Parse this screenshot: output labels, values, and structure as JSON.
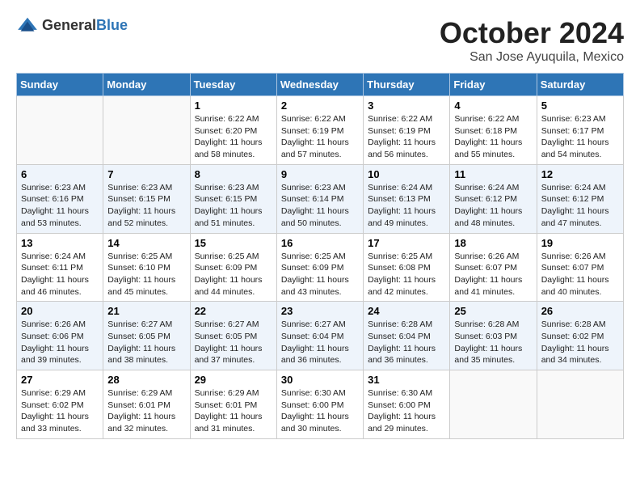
{
  "header": {
    "logo_general": "General",
    "logo_blue": "Blue",
    "month": "October 2024",
    "location": "San Jose Ayuquila, Mexico"
  },
  "weekdays": [
    "Sunday",
    "Monday",
    "Tuesday",
    "Wednesday",
    "Thursday",
    "Friday",
    "Saturday"
  ],
  "weeks": [
    [
      {
        "day": "",
        "empty": true
      },
      {
        "day": "",
        "empty": true
      },
      {
        "day": "1",
        "sunrise": "6:22 AM",
        "sunset": "6:20 PM",
        "daylight": "11 hours and 58 minutes."
      },
      {
        "day": "2",
        "sunrise": "6:22 AM",
        "sunset": "6:19 PM",
        "daylight": "11 hours and 57 minutes."
      },
      {
        "day": "3",
        "sunrise": "6:22 AM",
        "sunset": "6:19 PM",
        "daylight": "11 hours and 56 minutes."
      },
      {
        "day": "4",
        "sunrise": "6:22 AM",
        "sunset": "6:18 PM",
        "daylight": "11 hours and 55 minutes."
      },
      {
        "day": "5",
        "sunrise": "6:23 AM",
        "sunset": "6:17 PM",
        "daylight": "11 hours and 54 minutes."
      }
    ],
    [
      {
        "day": "6",
        "sunrise": "6:23 AM",
        "sunset": "6:16 PM",
        "daylight": "11 hours and 53 minutes."
      },
      {
        "day": "7",
        "sunrise": "6:23 AM",
        "sunset": "6:15 PM",
        "daylight": "11 hours and 52 minutes."
      },
      {
        "day": "8",
        "sunrise": "6:23 AM",
        "sunset": "6:15 PM",
        "daylight": "11 hours and 51 minutes."
      },
      {
        "day": "9",
        "sunrise": "6:23 AM",
        "sunset": "6:14 PM",
        "daylight": "11 hours and 50 minutes."
      },
      {
        "day": "10",
        "sunrise": "6:24 AM",
        "sunset": "6:13 PM",
        "daylight": "11 hours and 49 minutes."
      },
      {
        "day": "11",
        "sunrise": "6:24 AM",
        "sunset": "6:12 PM",
        "daylight": "11 hours and 48 minutes."
      },
      {
        "day": "12",
        "sunrise": "6:24 AM",
        "sunset": "6:12 PM",
        "daylight": "11 hours and 47 minutes."
      }
    ],
    [
      {
        "day": "13",
        "sunrise": "6:24 AM",
        "sunset": "6:11 PM",
        "daylight": "11 hours and 46 minutes."
      },
      {
        "day": "14",
        "sunrise": "6:25 AM",
        "sunset": "6:10 PM",
        "daylight": "11 hours and 45 minutes."
      },
      {
        "day": "15",
        "sunrise": "6:25 AM",
        "sunset": "6:09 PM",
        "daylight": "11 hours and 44 minutes."
      },
      {
        "day": "16",
        "sunrise": "6:25 AM",
        "sunset": "6:09 PM",
        "daylight": "11 hours and 43 minutes."
      },
      {
        "day": "17",
        "sunrise": "6:25 AM",
        "sunset": "6:08 PM",
        "daylight": "11 hours and 42 minutes."
      },
      {
        "day": "18",
        "sunrise": "6:26 AM",
        "sunset": "6:07 PM",
        "daylight": "11 hours and 41 minutes."
      },
      {
        "day": "19",
        "sunrise": "6:26 AM",
        "sunset": "6:07 PM",
        "daylight": "11 hours and 40 minutes."
      }
    ],
    [
      {
        "day": "20",
        "sunrise": "6:26 AM",
        "sunset": "6:06 PM",
        "daylight": "11 hours and 39 minutes."
      },
      {
        "day": "21",
        "sunrise": "6:27 AM",
        "sunset": "6:05 PM",
        "daylight": "11 hours and 38 minutes."
      },
      {
        "day": "22",
        "sunrise": "6:27 AM",
        "sunset": "6:05 PM",
        "daylight": "11 hours and 37 minutes."
      },
      {
        "day": "23",
        "sunrise": "6:27 AM",
        "sunset": "6:04 PM",
        "daylight": "11 hours and 36 minutes."
      },
      {
        "day": "24",
        "sunrise": "6:28 AM",
        "sunset": "6:04 PM",
        "daylight": "11 hours and 36 minutes."
      },
      {
        "day": "25",
        "sunrise": "6:28 AM",
        "sunset": "6:03 PM",
        "daylight": "11 hours and 35 minutes."
      },
      {
        "day": "26",
        "sunrise": "6:28 AM",
        "sunset": "6:02 PM",
        "daylight": "11 hours and 34 minutes."
      }
    ],
    [
      {
        "day": "27",
        "sunrise": "6:29 AM",
        "sunset": "6:02 PM",
        "daylight": "11 hours and 33 minutes."
      },
      {
        "day": "28",
        "sunrise": "6:29 AM",
        "sunset": "6:01 PM",
        "daylight": "11 hours and 32 minutes."
      },
      {
        "day": "29",
        "sunrise": "6:29 AM",
        "sunset": "6:01 PM",
        "daylight": "11 hours and 31 minutes."
      },
      {
        "day": "30",
        "sunrise": "6:30 AM",
        "sunset": "6:00 PM",
        "daylight": "11 hours and 30 minutes."
      },
      {
        "day": "31",
        "sunrise": "6:30 AM",
        "sunset": "6:00 PM",
        "daylight": "11 hours and 29 minutes."
      },
      {
        "day": "",
        "empty": true
      },
      {
        "day": "",
        "empty": true
      }
    ]
  ],
  "labels": {
    "sunrise": "Sunrise:",
    "sunset": "Sunset:",
    "daylight": "Daylight:"
  }
}
